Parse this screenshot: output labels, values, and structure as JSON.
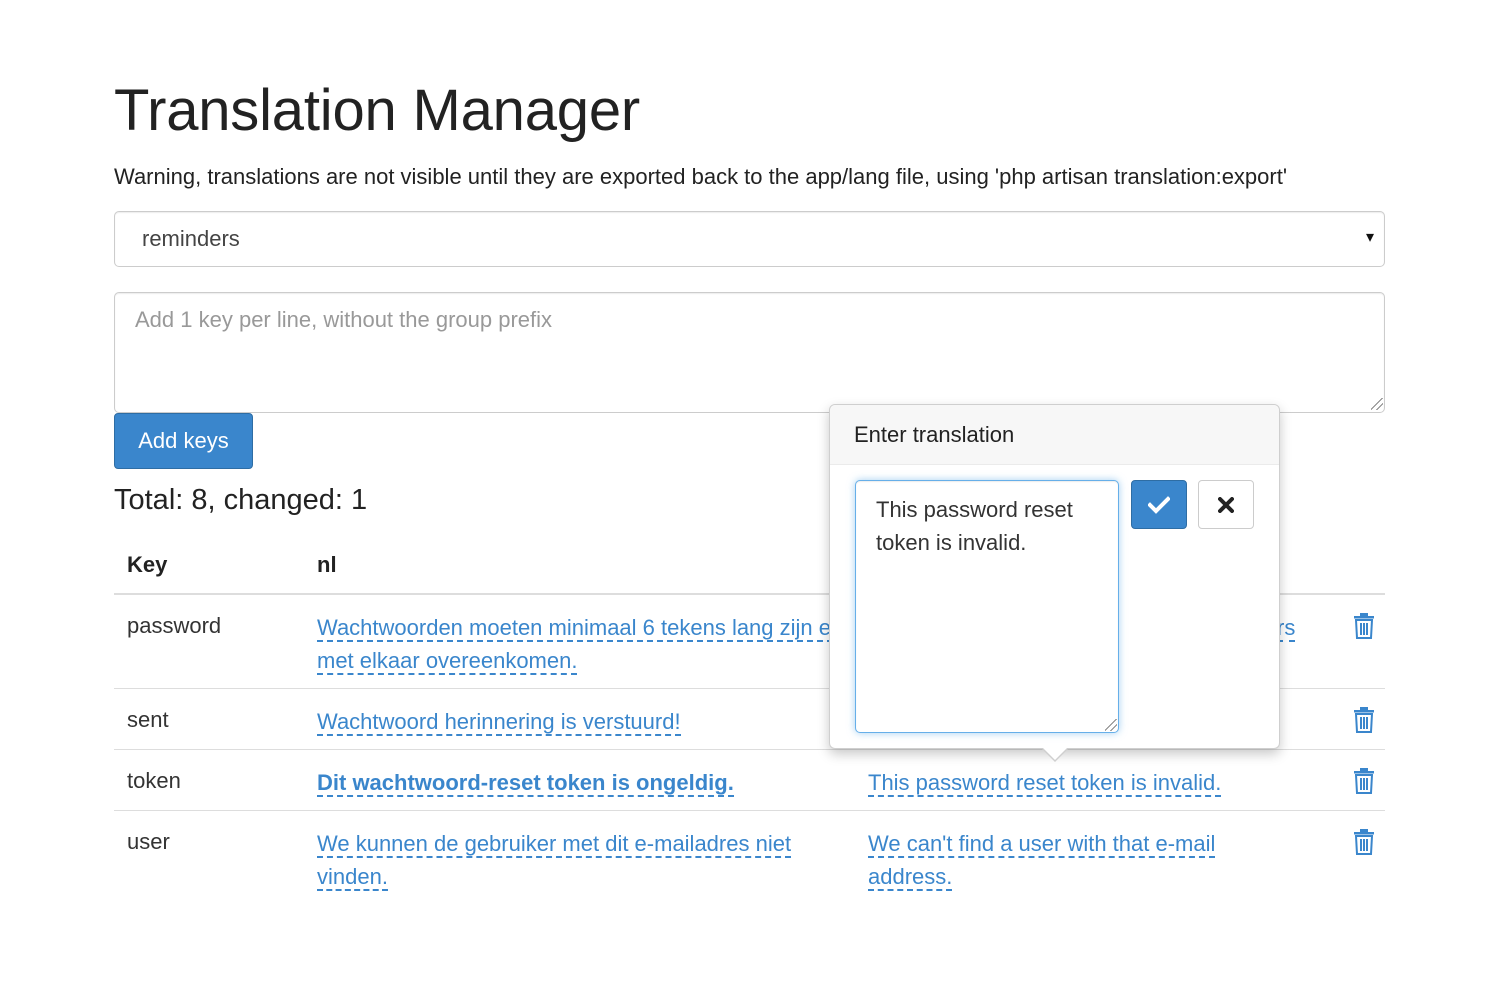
{
  "header": {
    "title": "Translation Manager",
    "warning": "Warning, translations are not visible until they are exported back to the app/lang file, using 'php artisan translation:export'"
  },
  "group_select": {
    "value": "reminders",
    "caret": "▾"
  },
  "add_keys": {
    "placeholder": "Add 1 key per line, without the group prefix",
    "button_label": "Add keys"
  },
  "summary": {
    "text": "Total: 8, changed: 1"
  },
  "table": {
    "headers": {
      "key": "Key",
      "nl": "nl"
    },
    "rows": [
      {
        "key": "password",
        "nl": "Wachtwoorden moeten minimaal 6 tekens lang zijn en met elkaar overeenkomen.",
        "en": "rs",
        "changed": false
      },
      {
        "key": "sent",
        "nl": "Wachtwoord herinnering is verstuurd!",
        "en": "",
        "changed": false
      },
      {
        "key": "token",
        "nl": "Dit wachtwoord-reset token is ongeldig.",
        "en": "This password reset token is invalid.",
        "changed": true
      },
      {
        "key": "user",
        "nl": "We kunnen de gebruiker met dit e-mailadres niet vinden.",
        "en": "We can't find a user with that e-mail address.",
        "changed": false
      }
    ]
  },
  "popover": {
    "title": "Enter translation",
    "input_value": "This password reset token is invalid."
  },
  "icons": {
    "trash": "trash-icon",
    "confirm": "check-icon",
    "cancel": "close-icon",
    "select_caret": "caret-down-icon"
  },
  "colors": {
    "primary": "#3a86cc",
    "link": "#3a86cc",
    "border": "#dddddd",
    "focus": "#66afe9"
  }
}
